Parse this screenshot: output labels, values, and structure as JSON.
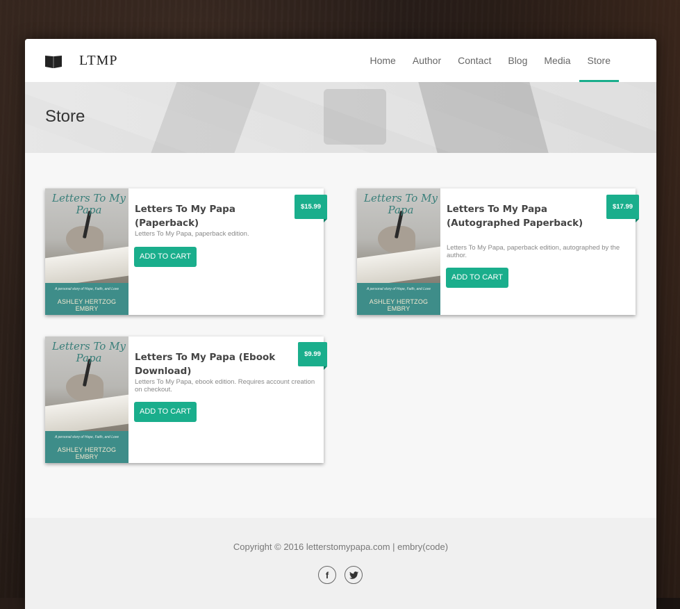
{
  "brand": {
    "name": "LTMP",
    "logo_icon": "book-icon"
  },
  "nav": {
    "items": [
      {
        "label": "Home"
      },
      {
        "label": "Author"
      },
      {
        "label": "Contact"
      },
      {
        "label": "Blog"
      },
      {
        "label": "Media"
      },
      {
        "label": "Store"
      }
    ],
    "active": "Store"
  },
  "hero": {
    "title": "Store"
  },
  "cover": {
    "title_line1": "Letters To My",
    "title_line2": "Papa",
    "subtitle": "A personal story of Hope, Faith, and Love",
    "author": "ASHLEY HERTZOG EMBRY"
  },
  "products": [
    {
      "title": "Letters To My Papa (Paperback)",
      "description": "Letters To My Papa, paperback edition.",
      "price": "$15.99",
      "button": "ADD TO CART"
    },
    {
      "title": "Letters To My Papa (Autographed Paperback)",
      "description": "Letters To My Papa, paperback edition, autographed by the author.",
      "price": "$17.99",
      "button": "ADD TO CART"
    },
    {
      "title": "Letters To My Papa (Ebook Download)",
      "description": "Letters To My Papa, ebook edition. Requires account creation on checkout.",
      "price": "$9.99",
      "button": "ADD TO CART"
    }
  ],
  "footer": {
    "copyright": "Copyright © 2016 letterstomypapa.com | embry(code)",
    "social": [
      {
        "icon": "facebook-icon",
        "glyph": "f"
      },
      {
        "icon": "twitter-icon",
        "glyph": "t"
      }
    ]
  },
  "colors": {
    "accent": "#1aae8c",
    "cover_band": "#3e8d89"
  }
}
